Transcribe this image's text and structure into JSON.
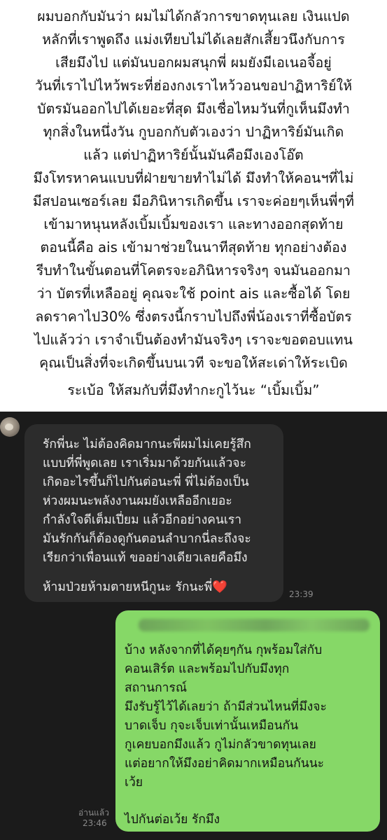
{
  "post": {
    "lines": [
      "ผมบอกกับมันว่า ผมไม่ได้กลัวการขาดทุนเลย เงินแปด",
      "หลักที่เราพูดถึง แม่งเทียบไม่ได้เลยสักเสี้ยวนึงกับการ",
      "เสียมึงไป แต่มันบอกผมสนุกพี่ ผมยังมีเอเนอจี้อยู่",
      "วันที่เราไปไหว้พระที่ฮ่องกงเราไหว้วอนขอปาฏิหาริย์ให้",
      "บัตรมันออกไปได้เยอะที่สุด มึงเชื่อไหมวันที่กูเห็นมึงทำ",
      "ทุกสิ่งในหนึ่งวัน กูบอกกับตัวเองว่า ปาฏิหาริย์มันเกิด",
      "แล้ว แต่ปาฏิหาริย์นั้นมันคือมึงเองโอ๊ต",
      "มึงโทรหาคนแบบที่ฝ่ายขายทำไม่ได้ มึงทำให้คอนฯที่ไม่",
      "มีสปอนเซอร์เลย มีอภินิหารเกิดขึ้น เราจะค่อยๆเห็นพี่ๆที่",
      "เข้ามาหนุนหลังเบิ้มเบิ้มของเรา และทางออกสุดท้าย",
      "ตอนนี้คือ ais เข้ามาช่วยในนาทีสุดท้าย  ทุกอย่างต้อง",
      "รีบทำในขั้นตอนที่โคตรจะอภินิหารจริงๆ จนมันออกมา",
      "ว่า บัตรที่เหลืออยู่ คุณจะใช้ point ais และซื้อได้ โดย",
      "ลดราคาไป30% ซึ่งตรงนี้กราบไปถึงพี่น้องเราที่ซื้อบัตร",
      "ไปแล้วว่า เราจำเป็นต้องทำมันจริงๆ เราจะขอตอบแทน",
      "คุณเป็นสิ่งที่จะเกิดขึ้นบนเวที จะขอให้สะเด่าให้ระเบิด",
      "ระเบ้อ ให้สมกับที่มึงทำกะกูไว้นะ “เบิ้มเบิ้ม”"
    ]
  },
  "chat": {
    "incoming": {
      "lines": [
        "รักพี่นะ ไม่ต้องคิดมากนะพี่ผมไม่เคยรู้สึก",
        "แบบที่พี่พูดเลย เราเริ่มมาด้วยกันแล้วจะ",
        "เกิดอะไรขึ้นก็ไปกันต่อนะพี่ พี่ไม่ต้องเป็น",
        "ห่วงผมนะพลังงานผมยังเหลืออีกเยอะ",
        "กำลังใจดีเต็มเปี่ยม แล้วอีกอย่างคนเรา",
        "มันรักกันก็ต้องดูกันตอนลำบากนี่ละถึงจะ",
        "เรียกว่าเพื่อนแท้ ขออย่างเดียวเลยคือมึง",
        "ห้ามป่วยห้ามตายหนีกูนะ รักนะพี่"
      ],
      "heart": "❤️",
      "time": "23:39"
    },
    "outgoing": {
      "lines": [
        "บ้าง หลังจากที่ได้คุยๆกัน กุพร้อมใส่กับ",
        "คอนเสิร์ต และพร้อมไปกับมึงทุก",
        "สถานการณ์",
        "มึงรับรู้ไว้ได้เลยว่า ถ้ามีส่วนไหนที่มึงจะ",
        "บาดเจ็บ กุจะเจ็บเท่านั้นเหมือนกัน",
        "กูเคยบอกมึงแล้ว กูไม่กลัวขาดทุนเลย",
        "แต่อยากให้มึงอย่าคิดมากเหมือนกันนะ",
        "เว้ย",
        "ไปกันต่อเว้ย รักมึง"
      ],
      "read_label": "อ่านแล้ว",
      "time": "23:46"
    }
  },
  "colors": {
    "chat_background": "#1b1b1b",
    "incoming_bubble": "#2c2c2c",
    "outgoing_bubble": "#86d867",
    "heart": "#e0262f"
  },
  "icons": {
    "avatar": "profile-avatar"
  }
}
